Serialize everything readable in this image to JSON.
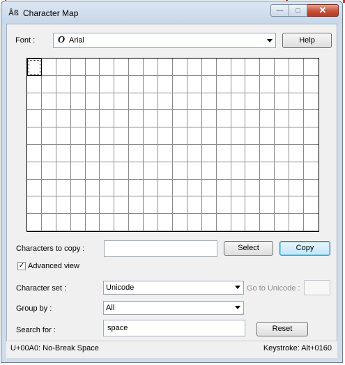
{
  "window": {
    "title": "Character Map",
    "app_icon": "Åß",
    "minimize_glyph": "—",
    "maximize_glyph": "□",
    "close_glyph": "✕"
  },
  "font": {
    "label": "Font :",
    "glyph": "O",
    "value": "Arial",
    "help_label": "Help"
  },
  "copy": {
    "label": "Characters to copy :",
    "value": "",
    "select_label": "Select",
    "copy_label": "Copy"
  },
  "advanced": {
    "label": "Advanced view",
    "checked": true,
    "check_glyph": "✓"
  },
  "charset": {
    "label": "Character set :",
    "value": "Unicode",
    "goto_label": "Go to Unicode :",
    "goto_value": ""
  },
  "group": {
    "label": "Group by :",
    "value": "All"
  },
  "search": {
    "label": "Search for :",
    "value": "space",
    "reset_label": "Reset"
  },
  "status": {
    "left": "U+00A0: No-Break Space",
    "right": "Keystroke: Alt+0160"
  },
  "colors": {
    "accent": "#3c7fb1",
    "close": "#c8513b"
  }
}
